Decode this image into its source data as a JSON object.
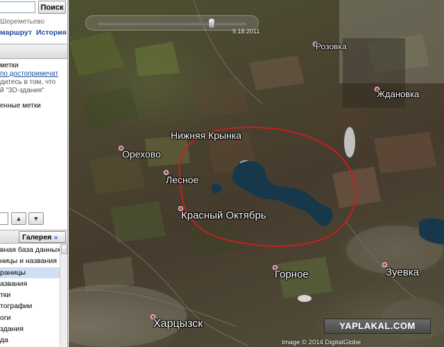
{
  "search": {
    "value": "",
    "button_label": "Поиск",
    "hint": "Шереметьево"
  },
  "links": {
    "route": "маршрут",
    "history": "История"
  },
  "places": {
    "line1": "метки",
    "line2": "по достопримечат",
    "line3": "дитесь в том, что",
    "line4": "й \"3D-здания\"",
    "line5": "енные метки"
  },
  "layers": {
    "gallery_label": "Галерея",
    "gallery_chevron": "»",
    "items": [
      {
        "label": "вная база данных",
        "selected": false
      },
      {
        "label": "ницы и названия",
        "selected": false
      },
      {
        "label": "раницы",
        "selected": true
      },
      {
        "label": "азвания",
        "selected": false
      },
      {
        "label": "тки",
        "selected": false
      },
      {
        "label": "тографии",
        "selected": false
      },
      {
        "label": "оги",
        "selected": false
      },
      {
        "label": "здания",
        "selected": false
      },
      {
        "label": "да",
        "selected": false
      }
    ]
  },
  "nav": {
    "up_icon": "▲",
    "down_icon": "▼"
  },
  "map": {
    "timeline_date": "9.18.2011",
    "timeline_position": 0.77,
    "credit": "Image © 2014 DigitalGlobe",
    "watermark": "YAPLAKAL.COM",
    "places": [
      {
        "name": "Розовка",
        "marker": true
      },
      {
        "name": "Ждановка",
        "marker": true
      },
      {
        "name": "Нижняя Крынка",
        "marker": false
      },
      {
        "name": "Орехово",
        "marker": true
      },
      {
        "name": "Лесное",
        "marker": true
      },
      {
        "name": "Красный Октябрь",
        "marker": true
      },
      {
        "name": "Горное",
        "marker": true
      },
      {
        "name": "Зуевка",
        "marker": true
      },
      {
        "name": "Харцызск",
        "marker": true
      }
    ],
    "colors": {
      "outline": "#c81e1e",
      "water": "#17384a",
      "marker": "#b5425c"
    }
  }
}
